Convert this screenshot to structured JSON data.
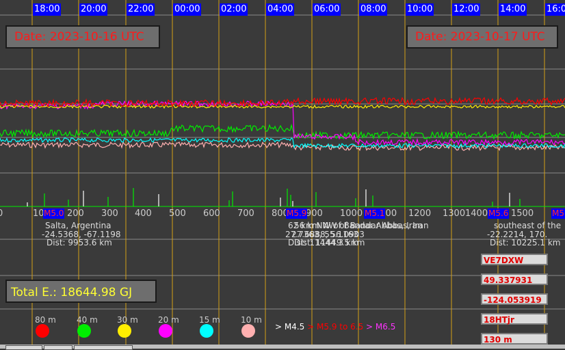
{
  "hour_labels": [
    "18:00",
    "20:00",
    "22:00",
    "00:00",
    "02:00",
    "04:00",
    "06:00",
    "08:00",
    "10:00",
    "12:00",
    "14:00",
    "16:0"
  ],
  "dates": [
    "Date: 2023-10-16 UTC",
    "Date: 2023-10-17 UTC"
  ],
  "x_ticks": [
    "0",
    "100",
    "200",
    "300",
    "400",
    "500",
    "600",
    "700",
    "800",
    "900",
    "1000",
    "1100",
    "1200",
    "1300",
    "1400",
    "1500"
  ],
  "quake_tags": [
    "M5.0",
    "M5.9",
    "M5.1",
    "M5.6",
    "M5"
  ],
  "quakes": [
    {
      "place": "Salta, Argentina",
      "coords": "-24.5368, -67.1198",
      "dist": "Dist: 9953.6 km"
    },
    {
      "place": "62 km NW of Bandar Abbas, Iran",
      "coords": "27.7363, 55.1163",
      "dist": "Dist: 11444.3 km"
    },
    {
      "place": "56 km NW of Bandar Abbas, Iran",
      "coords": "27.6888, 56.0903",
      "dist": "Dist: 11449.5 km"
    },
    {
      "place": "southeast of the",
      "coords": "-22.2214, 170.",
      "dist": "Dist: 10225.1 km"
    }
  ],
  "total_energy": "Total E.: 18644.98 GJ",
  "station": {
    "callsign": "VE7DXW",
    "lat": "49.337931",
    "lon": "-124.053919",
    "grid": "18HTjr",
    "band": "130 m"
  },
  "bands": [
    {
      "label": "80 m",
      "color": "#ff0000"
    },
    {
      "label": "40 m",
      "color": "#00ee00"
    },
    {
      "label": "30 m",
      "color": "#ffee00"
    },
    {
      "label": "20 m",
      "color": "#ff00ff"
    },
    {
      "label": "15 m",
      "color": "#00ffff"
    },
    {
      "label": "10 m",
      "color": "#ffb0b0"
    }
  ],
  "magnitude_legend": [
    {
      "text": "> M4.5",
      "color": "#ffffff"
    },
    {
      "text": "> M5.9 to 6.5",
      "color": "#ff0000"
    },
    {
      "text": "> M6.5",
      "color": "#ff33ff"
    }
  ]
}
